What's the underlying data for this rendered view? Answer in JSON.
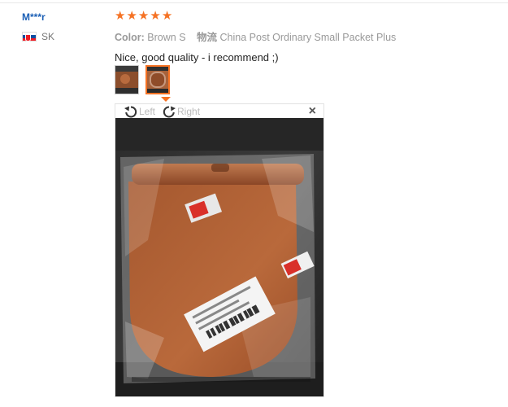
{
  "reviewer": {
    "name": "M***r",
    "country_code": "SK"
  },
  "review": {
    "stars": 5,
    "star_glyph": "★",
    "star_color": "#f57224",
    "color_label": "Color:",
    "color_value": "Brown S",
    "shipping_label": "物流",
    "shipping_value": "China Post Ordinary Small Packet Plus",
    "text": "Nice, good quality - i recommend ;)"
  },
  "images": {
    "count": 2,
    "active_index": 1
  },
  "viewer": {
    "rotate_left_label": "Left",
    "rotate_right_label": "Right",
    "close_glyph": "×"
  },
  "colors": {
    "name_link": "#1b5fb5",
    "accent": "#f57224"
  }
}
